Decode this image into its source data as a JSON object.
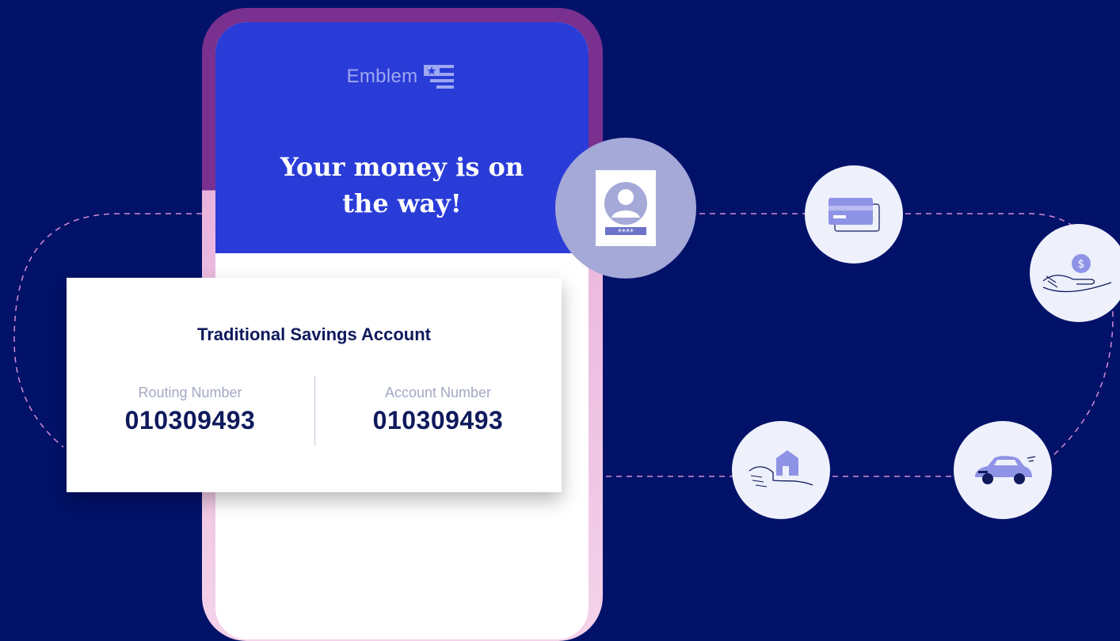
{
  "brand": {
    "name": "Emblem"
  },
  "screen": {
    "headline_line1": "Your money is on",
    "headline_line2": "the way!"
  },
  "account_card": {
    "title": "Traditional Savings Account",
    "routing_label": "Routing Number",
    "routing_value": "010309493",
    "account_label": "Account Number",
    "account_value": "010309493"
  },
  "id_card": {
    "masked": "****"
  },
  "icons": [
    "id-card-icon",
    "credit-card-icon",
    "hand-coin-icon",
    "hand-house-icon",
    "car-icon",
    "flag-logo-icon"
  ],
  "colors": {
    "background": "#021269",
    "header_blue": "#2a3cd8",
    "frame_purple": "#79308f",
    "frame_pink": "#f4d3ea",
    "text_navy": "#0f1a5c",
    "label_gray": "#a3a9c5",
    "dash_pink": "#d58ad8",
    "icon_lavender": "#8e93e6"
  }
}
